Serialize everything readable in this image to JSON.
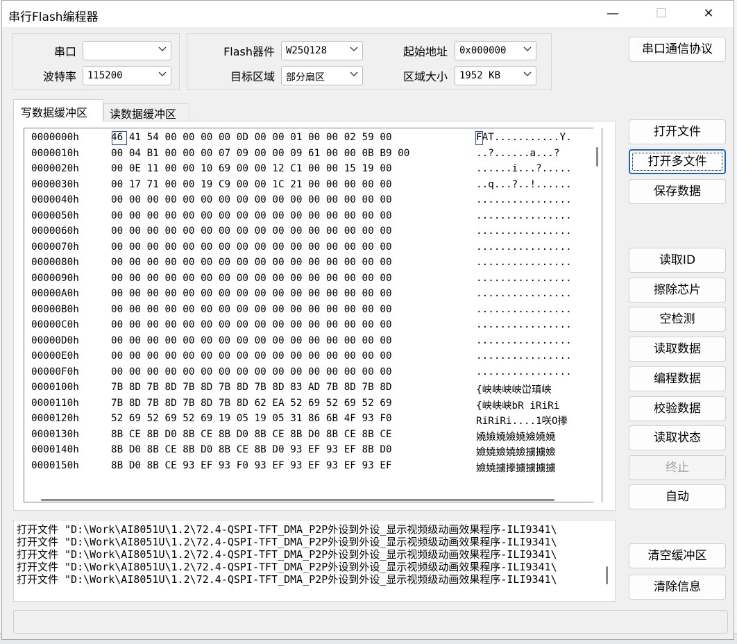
{
  "window": {
    "title": "串行Flash编程器",
    "min_glyph": "—",
    "max_glyph": "☐",
    "close_glyph": "✕"
  },
  "port_group": {
    "port_label": "串口",
    "port_value": "",
    "baud_label": "波特率",
    "baud_value": "115200"
  },
  "flash_group": {
    "device_label": "Flash器件",
    "device_value": "W25Q128",
    "target_label": "目标区域",
    "target_value": "部分扇区",
    "start_label": "起始地址",
    "start_value": "0x000000",
    "size_label": "区域大小",
    "size_value": "1952 KB"
  },
  "buttons": {
    "protocol": "串口通信协议",
    "open_file": "打开文件",
    "open_multi": "打开多文件",
    "save_data": "保存数据",
    "read_id": "读取ID",
    "erase_chip": "擦除芯片",
    "blank_check": "空检测",
    "read_data": "读取数据",
    "program_data": "编程数据",
    "verify_data": "校验数据",
    "read_status": "读取状态",
    "stop": "终止",
    "auto": "自动",
    "clear_buffer": "清空缓冲区",
    "clear_info": "清除信息"
  },
  "tabs": [
    "写数据缓冲区",
    "读数据缓冲区"
  ],
  "hex_rows": [
    {
      "addr": "0000000h",
      "bytes": "46 41 54 00 00 00 00 0D 00 00 01 00 00 02 59 00",
      "ascii": "FAT...........Y."
    },
    {
      "addr": "0000010h",
      "bytes": "00 04 B1 00 00 00 07 09 00 00 09 61 00 00 0B B9 00",
      "ascii": "..?......a...?"
    },
    {
      "addr": "0000020h",
      "bytes": "00 0E 11 00 00 10 69 00 00 12 C1 00 00 15 19 00",
      "ascii": "......i...?....."
    },
    {
      "addr": "0000030h",
      "bytes": "00 17 71 00 00 19 C9 00 00 1C 21 00 00 00 00 00",
      "ascii": "..q...?..!......"
    },
    {
      "addr": "0000040h",
      "bytes": "00 00 00 00 00 00 00 00 00 00 00 00 00 00 00 00",
      "ascii": "................"
    },
    {
      "addr": "0000050h",
      "bytes": "00 00 00 00 00 00 00 00 00 00 00 00 00 00 00 00",
      "ascii": "................"
    },
    {
      "addr": "0000060h",
      "bytes": "00 00 00 00 00 00 00 00 00 00 00 00 00 00 00 00",
      "ascii": "................"
    },
    {
      "addr": "0000070h",
      "bytes": "00 00 00 00 00 00 00 00 00 00 00 00 00 00 00 00",
      "ascii": "................"
    },
    {
      "addr": "0000080h",
      "bytes": "00 00 00 00 00 00 00 00 00 00 00 00 00 00 00 00",
      "ascii": "................"
    },
    {
      "addr": "0000090h",
      "bytes": "00 00 00 00 00 00 00 00 00 00 00 00 00 00 00 00",
      "ascii": "................"
    },
    {
      "addr": "00000A0h",
      "bytes": "00 00 00 00 00 00 00 00 00 00 00 00 00 00 00 00",
      "ascii": "................"
    },
    {
      "addr": "00000B0h",
      "bytes": "00 00 00 00 00 00 00 00 00 00 00 00 00 00 00 00",
      "ascii": "................"
    },
    {
      "addr": "00000C0h",
      "bytes": "00 00 00 00 00 00 00 00 00 00 00 00 00 00 00 00",
      "ascii": "................"
    },
    {
      "addr": "00000D0h",
      "bytes": "00 00 00 00 00 00 00 00 00 00 00 00 00 00 00 00",
      "ascii": "................"
    },
    {
      "addr": "00000E0h",
      "bytes": "00 00 00 00 00 00 00 00 00 00 00 00 00 00 00 00",
      "ascii": "................"
    },
    {
      "addr": "00000F0h",
      "bytes": "00 00 00 00 00 00 00 00 00 00 00 00 00 00 00 00",
      "ascii": "................"
    },
    {
      "addr": "0000100h",
      "bytes": "7B 8D 7B 8D 7B 8D 7B 8D 7B 8D 83 AD 7B 8D 7B 8D",
      "ascii": "{峡峡峡峡峃瑱峡"
    },
    {
      "addr": "0000110h",
      "bytes": "7B 8D 7B 8D 7B 8D 7B 8D 62 EA 52 69 52 69 52 69",
      "ascii": "{峡峡峡bR iRiRi"
    },
    {
      "addr": "0000120h",
      "bytes": "52 69 52 69 52 69 19 05 19 05 31 86 6B 4F 93 F0",
      "ascii": "RiRiRi....1咲O搼"
    },
    {
      "addr": "0000130h",
      "bytes": "8B CE 8B D0 8B CE 8B D0 8B CE 8B D0 8B CE 8B CE",
      "ascii": "嬈嬐嬈嬐嬈嬐嬈嬈"
    },
    {
      "addr": "0000140h",
      "bytes": "8B D0 8B CE 8B D0 8B CE 8B D0 93 EF 93 EF 8B D0",
      "ascii": "嬐嬈嬐嬈嬐擄擄嬐"
    },
    {
      "addr": "0000150h",
      "bytes": "8B D0 8B CE 93 EF 93 F0 93 EF 93 EF 93 EF 93 EF",
      "ascii": "嬐嬈擄搼擄擄擄擄"
    }
  ],
  "log_lines": [
    "打开文件 \"D:\\Work\\AI8051U\\1.2\\72.4-QSPI-TFT_DMA_P2P外设到外设_显示视频级动画效果程序-ILI9341\\",
    "打开文件 \"D:\\Work\\AI8051U\\1.2\\72.4-QSPI-TFT_DMA_P2P外设到外设_显示视频级动画效果程序-ILI9341\\",
    "打开文件 \"D:\\Work\\AI8051U\\1.2\\72.4-QSPI-TFT_DMA_P2P外设到外设_显示视频级动画效果程序-ILI9341\\",
    "打开文件 \"D:\\Work\\AI8051U\\1.2\\72.4-QSPI-TFT_DMA_P2P外设到外设_显示视频级动画效果程序-ILI9341\\",
    "打开文件 \"D:\\Work\\AI8051U\\1.2\\72.4-QSPI-TFT_DMA_P2P外设到外设_显示视频级动画效果程序-ILI9341\\"
  ]
}
